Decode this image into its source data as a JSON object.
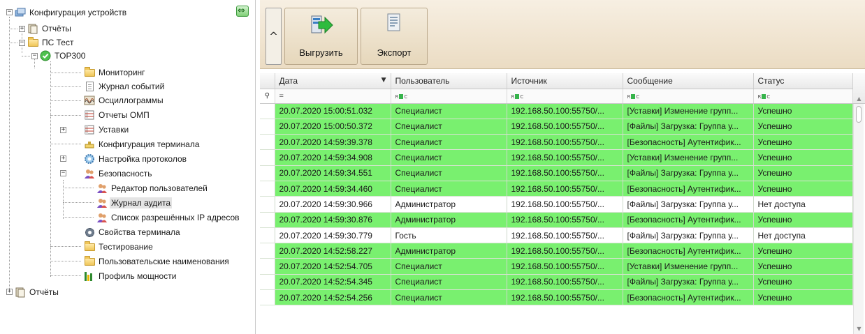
{
  "tree": {
    "root": "Конфигурация устройств",
    "items": [
      {
        "label": "Отчёты"
      },
      {
        "label": "ПС Тест"
      },
      {
        "label": "TOP300"
      },
      {
        "label": "Мониторинг"
      },
      {
        "label": "Журнал событий"
      },
      {
        "label": "Осциллограммы"
      },
      {
        "label": "Отчеты ОМП"
      },
      {
        "label": "Уставки"
      },
      {
        "label": "Конфигурация терминала"
      },
      {
        "label": "Настройка протоколов"
      },
      {
        "label": "Безопасность"
      },
      {
        "label": "Редактор пользователей"
      },
      {
        "label": "Журнал аудита"
      },
      {
        "label": "Список разрешённых IP адресов"
      },
      {
        "label": "Свойства терминала"
      },
      {
        "label": "Тестирование"
      },
      {
        "label": "Пользовательские наименования"
      },
      {
        "label": "Профиль мощности"
      },
      {
        "label": "Отчёты"
      }
    ]
  },
  "toolbar": {
    "collapse_icon": "^",
    "export_label": "Выгрузить",
    "export_icon": "export-arrow-icon",
    "export2_label": "Экспорт",
    "export2_icon": "document-icon"
  },
  "grid": {
    "columns": [
      "Дата",
      "Пользователь",
      "Источник",
      "Сообщение",
      "Статус"
    ],
    "filter_indicator": "=",
    "filter_pin": "📌",
    "rows": [
      {
        "date": "20.07.2020 15:00:51.032",
        "user": "Специалист",
        "source": "192.168.50.100:55750/...",
        "message": "[Уставки] Изменение групп...",
        "status": "Успешно",
        "state": "ok"
      },
      {
        "date": "20.07.2020 15:00:50.372",
        "user": "Специалист",
        "source": "192.168.50.100:55750/...",
        "message": "[Файлы] Загрузка: Группа у...",
        "status": "Успешно",
        "state": "ok"
      },
      {
        "date": "20.07.2020 14:59:39.378",
        "user": "Специалист",
        "source": "192.168.50.100:55750/...",
        "message": "[Безопасность] Аутентифик...",
        "status": "Успешно",
        "state": "ok"
      },
      {
        "date": "20.07.2020 14:59:34.908",
        "user": "Специалист",
        "source": "192.168.50.100:55750/...",
        "message": "[Уставки] Изменение групп...",
        "status": "Успешно",
        "state": "ok"
      },
      {
        "date": "20.07.2020 14:59:34.551",
        "user": "Специалист",
        "source": "192.168.50.100:55750/...",
        "message": "[Файлы] Загрузка: Группа у...",
        "status": "Успешно",
        "state": "ok"
      },
      {
        "date": "20.07.2020 14:59:34.460",
        "user": "Специалист",
        "source": "192.168.50.100:55750/...",
        "message": "[Безопасность] Аутентифик...",
        "status": "Успешно",
        "state": "ok"
      },
      {
        "date": "20.07.2020 14:59:30.966",
        "user": "Администратор",
        "source": "192.168.50.100:55750/...",
        "message": "[Файлы] Загрузка: Группа у...",
        "status": "Нет доступа",
        "state": "deny"
      },
      {
        "date": "20.07.2020 14:59:30.876",
        "user": "Администратор",
        "source": "192.168.50.100:55750/...",
        "message": "[Безопасность] Аутентифик...",
        "status": "Успешно",
        "state": "ok"
      },
      {
        "date": "20.07.2020 14:59:30.779",
        "user": "Гость",
        "source": "192.168.50.100:55750/...",
        "message": "[Файлы] Загрузка: Группа у...",
        "status": "Нет доступа",
        "state": "deny"
      },
      {
        "date": "20.07.2020 14:52:58.227",
        "user": "Администратор",
        "source": "192.168.50.100:55750/...",
        "message": "[Безопасность] Аутентифик...",
        "status": "Успешно",
        "state": "ok"
      },
      {
        "date": "20.07.2020 14:52:54.705",
        "user": "Специалист",
        "source": "192.168.50.100:55750/...",
        "message": "[Уставки] Изменение групп...",
        "status": "Успешно",
        "state": "ok"
      },
      {
        "date": "20.07.2020 14:52:54.345",
        "user": "Специалист",
        "source": "192.168.50.100:55750/...",
        "message": "[Файлы] Загрузка: Группа у...",
        "status": "Успешно",
        "state": "ok"
      },
      {
        "date": "20.07.2020 14:52:54.256",
        "user": "Специалист",
        "source": "192.168.50.100:55750/...",
        "message": "[Безопасность] Аутентифик...",
        "status": "Успешно",
        "state": "ok"
      }
    ]
  },
  "colors": {
    "ok_row": "#79f06f",
    "deny_row": "#ffffff",
    "toolbar_bg": "#ebdcc3"
  }
}
